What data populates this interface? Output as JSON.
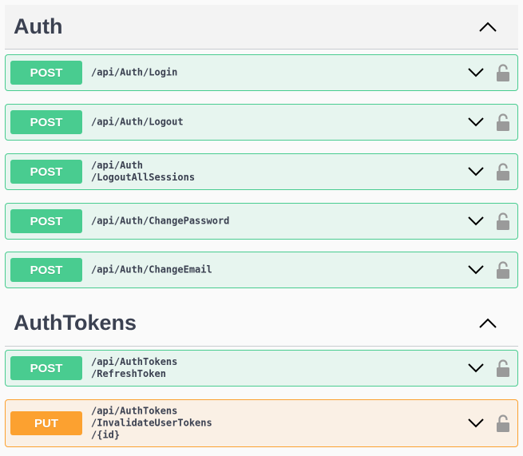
{
  "sections": [
    {
      "title": "Auth",
      "operations": [
        {
          "method": "POST",
          "path_lines": [
            "/api/Auth/Login"
          ]
        },
        {
          "method": "POST",
          "path_lines": [
            "/api/Auth/Logout"
          ]
        },
        {
          "method": "POST",
          "path_lines": [
            "/api/Auth",
            "/LogoutAllSessions"
          ]
        },
        {
          "method": "POST",
          "path_lines": [
            "/api/Auth/ChangePassword"
          ]
        },
        {
          "method": "POST",
          "path_lines": [
            "/api/Auth/ChangeEmail"
          ]
        }
      ]
    },
    {
      "title": "AuthTokens",
      "operations": [
        {
          "method": "POST",
          "path_lines": [
            "/api/AuthTokens",
            "/RefreshToken"
          ]
        },
        {
          "method": "PUT",
          "path_lines": [
            "/api/AuthTokens",
            "/InvalidateUserTokens",
            "/{id}"
          ]
        }
      ]
    }
  ],
  "colors": {
    "post": "#49cc90",
    "put": "#fca130",
    "text": "#3b4151",
    "icon": "#9a9a9a"
  },
  "icons": {
    "section_toggle": "chevron-up-icon",
    "op_expand": "chevron-down-icon",
    "auth": "lock-icon"
  }
}
